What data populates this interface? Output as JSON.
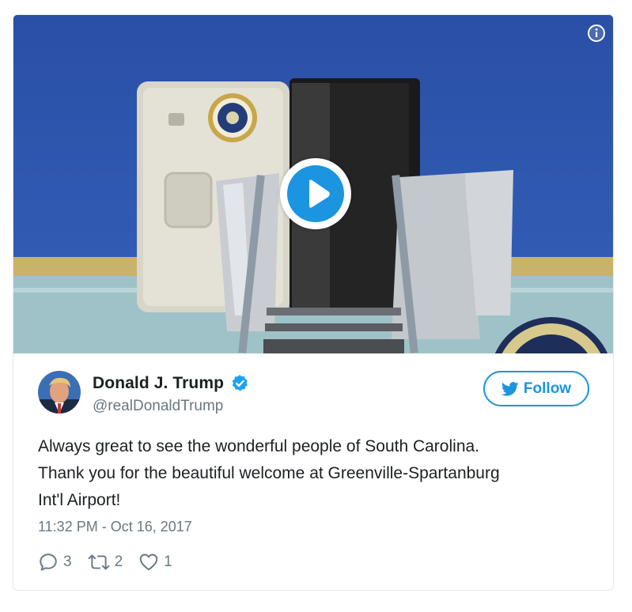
{
  "media": {
    "icons": {
      "info": "info-icon",
      "play": "play-icon"
    }
  },
  "author": {
    "name": "Donald J. Trump",
    "handle": "@realDonaldTrump",
    "verified_icon": "verified-badge-icon"
  },
  "follow": {
    "label": "Follow",
    "icon": "twitter-bird-icon"
  },
  "tweet": {
    "lines": [
      "Always great to see the wonderful people of South Carolina.",
      "Thank you for the beautiful welcome at Greenville-Spartanburg",
      "Int'l Airport!"
    ],
    "timestamp": "11:32 PM - Oct 16, 2017"
  },
  "actions": {
    "replies": "3",
    "retweets": "2",
    "likes": "1"
  },
  "colors": {
    "accent": "#1b95e0",
    "muted": "#697882",
    "text": "#1c2022",
    "plane_blue": "#2d52a8"
  }
}
